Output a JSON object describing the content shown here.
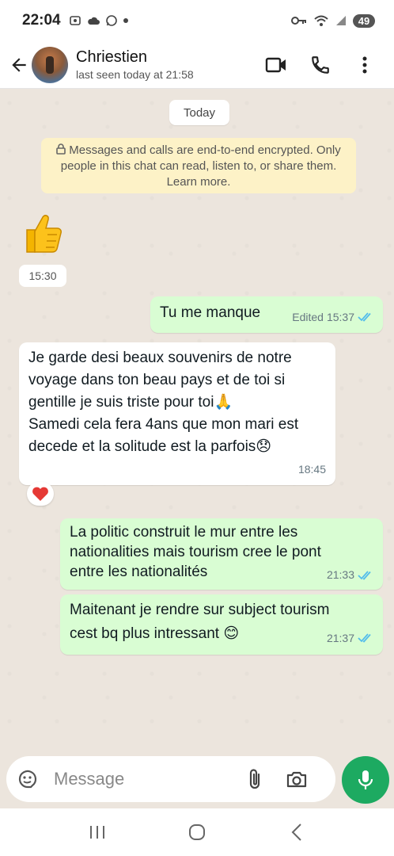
{
  "status_bar": {
    "time": "22:04",
    "left_icons": [
      "screen-record-icon",
      "cloud-icon",
      "whatsapp-icon",
      "dot-icon"
    ],
    "right_icons": [
      "key-icon",
      "wifi-icon",
      "signal-icon"
    ],
    "battery": "49"
  },
  "header": {
    "contact_name": "Chriestien",
    "last_seen": "last seen today at 21:58",
    "actions": [
      "video-call-icon",
      "voice-call-icon",
      "more-options-icon"
    ]
  },
  "chat": {
    "date_chip": "Today",
    "encryption_notice": "Messages and calls are end-to-end encrypted. Only people in this chat can read, listen to, or share them. Learn more.",
    "messages": [
      {
        "direction": "in",
        "type": "emoji",
        "content": "👍",
        "time": "15:30"
      },
      {
        "direction": "out",
        "text": "Tu me manque",
        "edited": "Edited",
        "time": "15:37",
        "status": "read"
      },
      {
        "direction": "in",
        "lines": [
          "Je garde desi beaux souvenirs de notre",
          "voyage dans ton beau pays et de toi si",
          "gentille je suis triste  pour toi🙏",
          "Samedi cela fera 4ans que mon mari est",
          "decede et  la solitude est la parfois😞"
        ],
        "time": "18:45",
        "reaction": "❤️"
      },
      {
        "direction": "out",
        "lines": [
          "La politic construit le mur entre les",
          "nationalities mais tourism cree le pont",
          "entre les nationalités"
        ],
        "time": "21:33",
        "status": "read"
      },
      {
        "direction": "out",
        "lines": [
          "Maitenant je rendre sur subject tourism",
          "cest bq plus intressant 😊"
        ],
        "time": "21:37",
        "status": "read"
      }
    ]
  },
  "input": {
    "placeholder": "Message"
  },
  "colors": {
    "accent_green": "#1daa61",
    "outgoing_bubble": "#d9fdd3",
    "incoming_bubble": "#ffffff",
    "notice_bg": "#fdf2c7",
    "read_tick": "#53bdeb"
  }
}
